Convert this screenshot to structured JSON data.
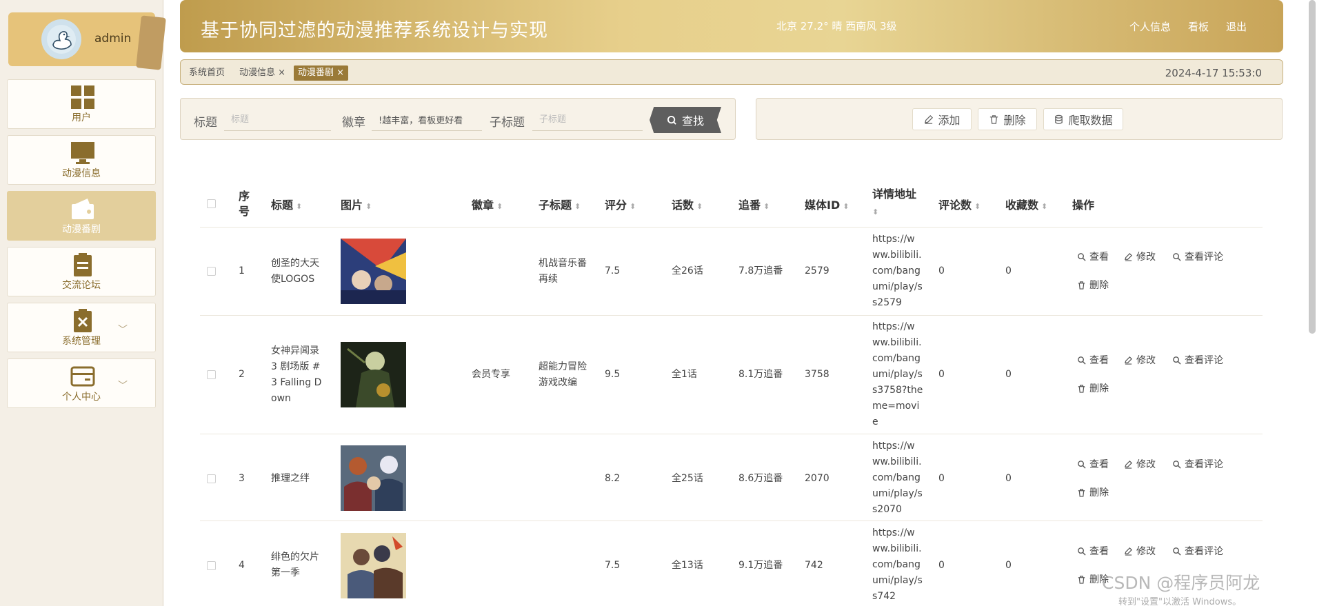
{
  "user": {
    "name": "admin"
  },
  "nav": [
    {
      "label": "用户",
      "icon": "grid-icon"
    },
    {
      "label": "动漫信息",
      "icon": "monitor-icon"
    },
    {
      "label": "动漫番剧",
      "icon": "wallet-icon",
      "active": true
    },
    {
      "label": "交流论坛",
      "icon": "clipboard-icon"
    },
    {
      "label": "系统管理",
      "icon": "clipboard-x-icon",
      "expandable": true
    },
    {
      "label": "个人中心",
      "icon": "card-icon",
      "expandable": true
    }
  ],
  "header": {
    "title": "基于协同过滤的动漫推荐系统设计与实现",
    "weather": "北京  27.2°  晴  西南风  3级",
    "links": [
      "个人信息",
      "看板",
      "退出"
    ]
  },
  "breadcrumbs": {
    "items": [
      "系统首页",
      "动漫信息 ×",
      "动漫番剧 ×"
    ],
    "datetime": "2024-4-17 15:53:0"
  },
  "search": {
    "title_label": "标题",
    "title_placeholder": "标题",
    "badge_label": "徽章",
    "badge_value": "!越丰富，看板更好看",
    "subtitle_label": "子标题",
    "subtitle_placeholder": "子标题",
    "button": "查找"
  },
  "actions": {
    "add": "添加",
    "delete": "删除",
    "crawl": "爬取数据"
  },
  "table": {
    "headers": [
      "序号",
      "标题",
      "图片",
      "徽章",
      "子标题",
      "评分",
      "话数",
      "追番",
      "媒体ID",
      "详情地址",
      "评论数",
      "收藏数",
      "操作"
    ],
    "rows": [
      {
        "index": "1",
        "title_lines": [
          "创圣的大天",
          "使LOGOS"
        ],
        "badge": "",
        "subtitle_lines": [
          "机战音乐番",
          "再续"
        ],
        "score": "7.5",
        "episodes": "全26话",
        "follow": "7.8万追番",
        "media_id": "2579",
        "url_lines": [
          "https://w",
          "ww.bilibili.",
          "com/bang",
          "umi/play/s",
          "s2579"
        ],
        "comments": "0",
        "favorites": "0"
      },
      {
        "index": "2",
        "title_lines": [
          "女神异闻录",
          "3 剧场版 #",
          "3 Falling D",
          "own"
        ],
        "badge": "会员专享",
        "subtitle_lines": [
          "超能力冒险",
          "游戏改编"
        ],
        "score": "9.5",
        "episodes": "全1话",
        "follow": "8.1万追番",
        "media_id": "3758",
        "url_lines": [
          "https://w",
          "ww.bilibili.",
          "com/bang",
          "umi/play/s",
          "s3758?the",
          "me=movi",
          "e"
        ],
        "comments": "0",
        "favorites": "0"
      },
      {
        "index": "3",
        "title_lines": [
          "推理之绊"
        ],
        "badge": "",
        "subtitle_lines": [],
        "score": "8.2",
        "episodes": "全25话",
        "follow": "8.6万追番",
        "media_id": "2070",
        "url_lines": [
          "https://w",
          "ww.bilibili.",
          "com/bang",
          "umi/play/s",
          "s2070"
        ],
        "comments": "0",
        "favorites": "0"
      },
      {
        "index": "4",
        "title_lines": [
          "绯色的欠片",
          "第一季"
        ],
        "badge": "",
        "subtitle_lines": [],
        "score": "7.5",
        "episodes": "全13话",
        "follow": "9.1万追番",
        "media_id": "742",
        "url_lines": [
          "https://w",
          "ww.bilibili.",
          "com/bang",
          "umi/play/s",
          "s742"
        ],
        "comments": "0",
        "favorites": "0"
      }
    ],
    "row_ops": [
      "查看",
      "修改",
      "查看评论",
      "删除"
    ]
  },
  "watermark": {
    "text": "CSDN @程序员阿龙",
    "sub": "转到\"设置\"以激活 Windows。"
  },
  "colors": {
    "accent": "#c9a55a",
    "active_nav": "#e3cf9c",
    "tab_active": "#9a7a38"
  }
}
